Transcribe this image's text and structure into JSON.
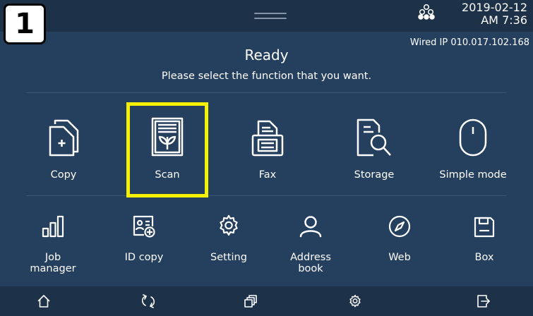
{
  "step_badge": "1",
  "header": {
    "date": "2019-02-12",
    "time": "AM 7:36",
    "network_icon": "network-status-icon",
    "wired_ip": "Wired IP 010.017.102.168"
  },
  "status": {
    "title": "Ready",
    "subtitle": "Please select the function that you want."
  },
  "main_apps": [
    {
      "label": "Copy",
      "icon": "copy-icon"
    },
    {
      "label": "Scan",
      "icon": "scan-icon",
      "highlighted": true
    },
    {
      "label": "Fax",
      "icon": "fax-icon"
    },
    {
      "label": "Storage",
      "icon": "storage-icon"
    },
    {
      "label": "Simple mode",
      "icon": "simple-mode-icon"
    }
  ],
  "secondary_apps": [
    {
      "label_line1": "Job",
      "label_line2": "manager",
      "icon": "job-manager-icon"
    },
    {
      "label_line1": "ID copy",
      "label_line2": "",
      "icon": "id-copy-icon"
    },
    {
      "label_line1": "Setting",
      "label_line2": "",
      "icon": "setting-icon"
    },
    {
      "label_line1": "Address",
      "label_line2": "book",
      "icon": "address-book-icon"
    },
    {
      "label_line1": "Web",
      "label_line2": "",
      "icon": "web-icon"
    },
    {
      "label_line1": "Box",
      "label_line2": "",
      "icon": "box-icon"
    }
  ],
  "bottom_nav": [
    "home-icon",
    "reset-icon",
    "recent-jobs-icon",
    "settings-icon",
    "logout-icon"
  ],
  "colors": {
    "background": "#253f5e",
    "bars": "#1d3248",
    "highlight": "#f5f000",
    "text": "#ffffff"
  }
}
